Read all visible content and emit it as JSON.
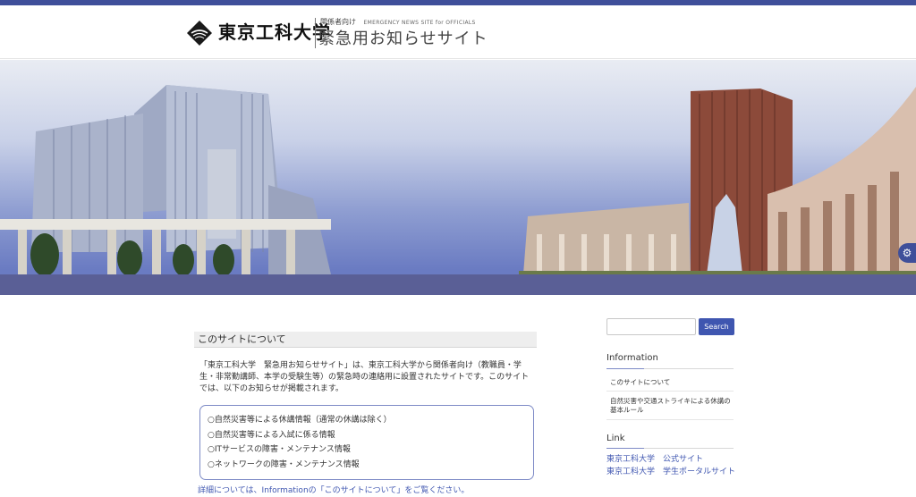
{
  "header": {
    "logo_university": "東京工科大学",
    "logo_audience": "関係者向け",
    "logo_english": "EMERGENCY NEWS SITE for OFFICIALS",
    "logo_title": "緊急用お知らせサイト"
  },
  "main": {
    "section_title": "このサイトについて",
    "intro_text": "「東京工科大学　緊急用お知らせサイト」は、東京工科大学から関係者向け（教職員・学生・非常勤講師、本学の受験生等）の緊急時の連絡用に設置されたサイトです。このサイトでは、以下のお知らせが掲載されます。",
    "items": [
      "○自然災害等による休講情報（通常の休講は除く）",
      "○自然災害等による入試に係る情報",
      "○ITサービスの障害・メンテナンス情報",
      "○ネットワークの障害・メンテナンス情報"
    ],
    "details_text": "詳細については、Informationの「このサイトについて」をご覧ください。"
  },
  "sidebar": {
    "search_button": "Search",
    "search_placeholder": "",
    "information_title": "Information",
    "information_items": [
      "このサイトについて",
      "自然災害や交通ストライキによる休講の基本ルール"
    ],
    "link_title": "Link",
    "links": [
      "東京工科大学　公式サイト",
      "東京工科大学　学生ポータルサイト"
    ]
  },
  "colors": {
    "accent": "#3f56b0",
    "topbar": "#3f4f9a",
    "band": "#5a5f96"
  },
  "icons": {
    "logo": "tut-logo-mark",
    "side_tab": "accessibility-icon"
  }
}
